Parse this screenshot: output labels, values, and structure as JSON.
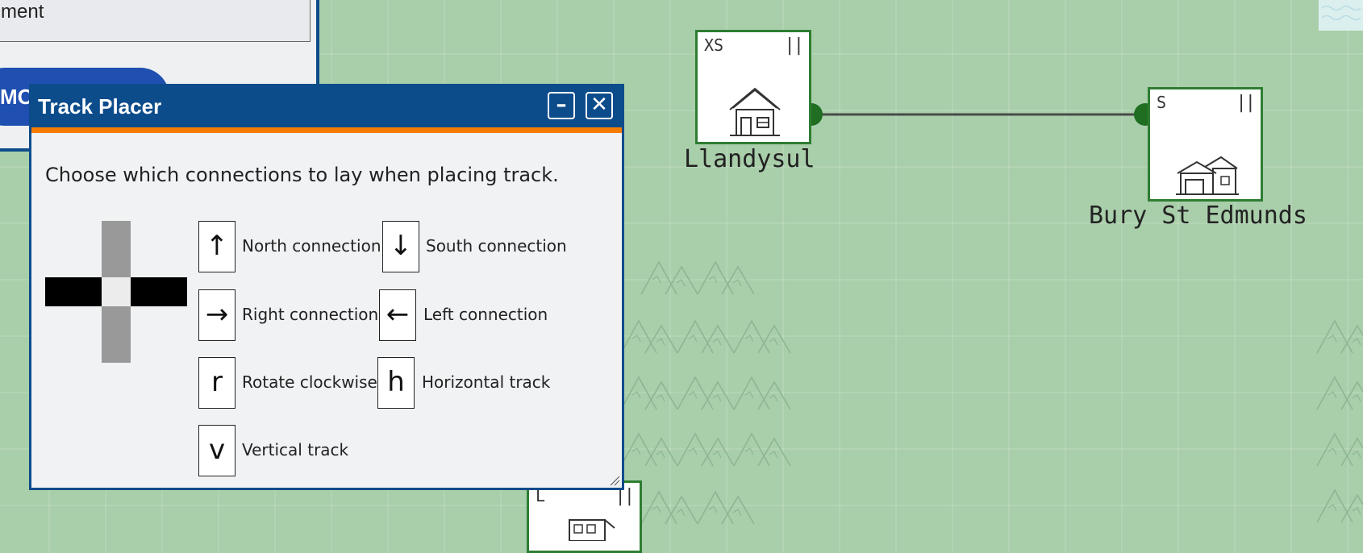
{
  "map": {
    "stations": [
      {
        "name": "Llandysul",
        "size": "XS",
        "pause": "||"
      },
      {
        "name": "Bury St Edmunds",
        "size": "S",
        "pause": "||"
      },
      {
        "name": "",
        "size": "L",
        "pause": "||"
      }
    ],
    "track_color": "#4a4a4a",
    "station_border_color": "#2e7d32",
    "terrain": "mountains"
  },
  "side_panel": {
    "field_text": "ment",
    "move_button_label": "MOV"
  },
  "dialog": {
    "title": "Track Placer",
    "minimize_label": "–",
    "close_label": "✕",
    "instructions": "Choose which connections to lay when placing track.",
    "keys": [
      {
        "key": "↑",
        "label": "North connection"
      },
      {
        "key": "↓",
        "label": "South connection"
      },
      {
        "key": "→",
        "label": "Right connection"
      },
      {
        "key": "←",
        "label": "Left connection"
      },
      {
        "key": "r",
        "label": "Rotate clockwise"
      },
      {
        "key": "h",
        "label": "Horizontal track"
      },
      {
        "key": "v",
        "label": "Vertical track"
      }
    ],
    "colors": {
      "title_bar": "#0d4c8b",
      "accent": "#f57c00",
      "active_connection": "#000000",
      "inactive_connection": "#999999"
    }
  }
}
